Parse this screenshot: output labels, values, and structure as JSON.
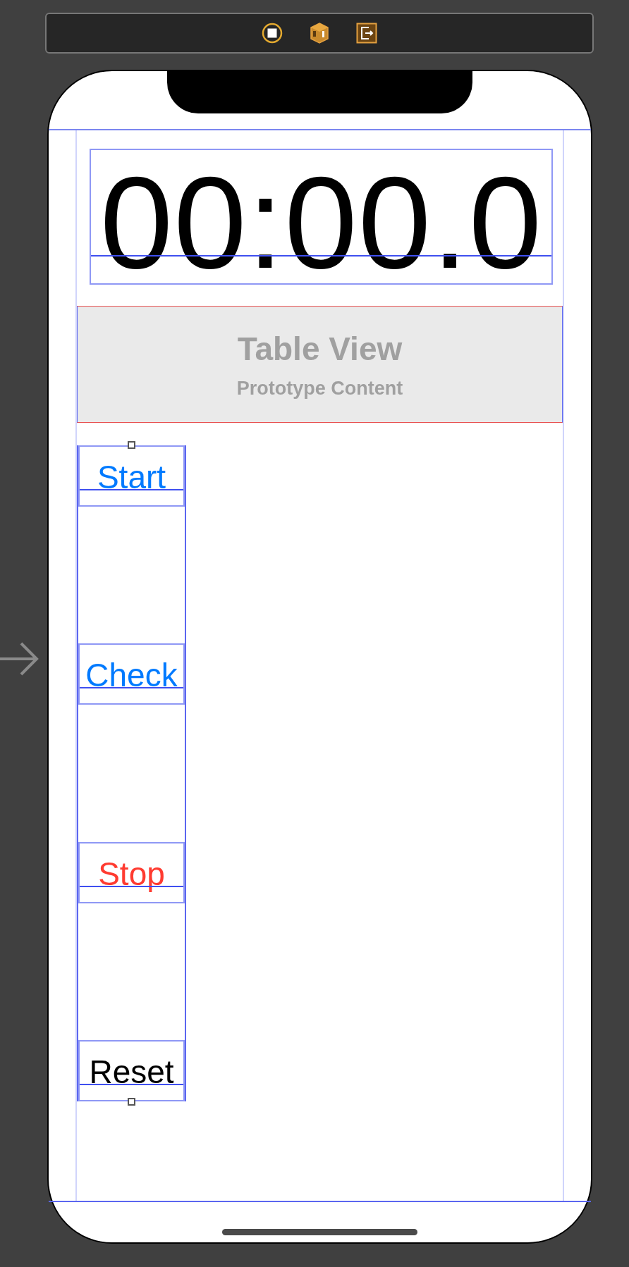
{
  "time_label": "00:00.0",
  "table_view": {
    "title": "Table View",
    "subtitle": "Prototype Content"
  },
  "buttons": [
    {
      "label": "Start",
      "color": "#007aff"
    },
    {
      "label": "Check",
      "color": "#007aff"
    },
    {
      "label": "Stop",
      "color": "#ff3b30"
    },
    {
      "label": "Reset",
      "color": "#000000"
    }
  ]
}
